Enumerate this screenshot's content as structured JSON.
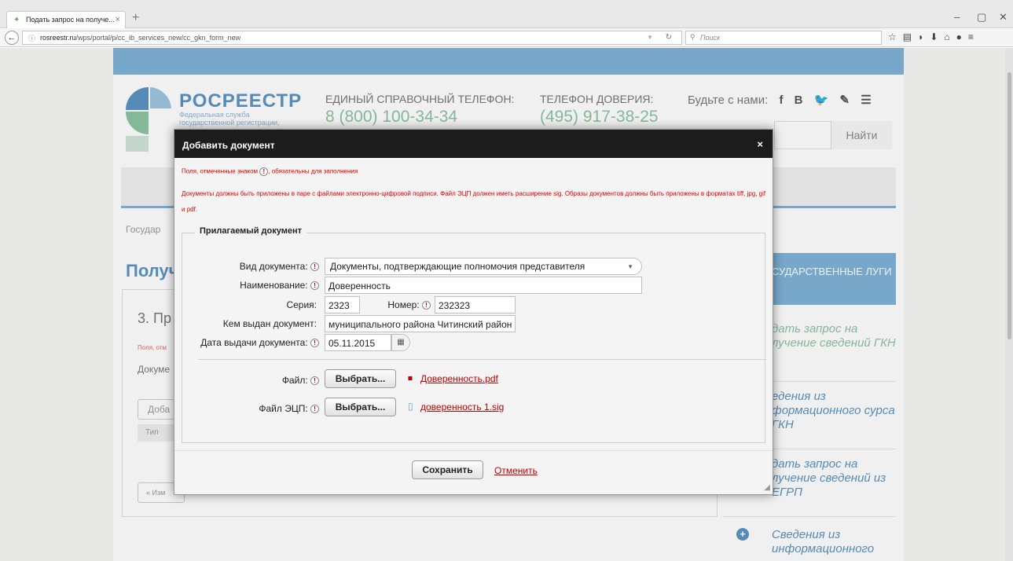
{
  "browser": {
    "tab_title": "Подать запрос на получе...",
    "tab_close": "×",
    "new_tab": "+",
    "url_host": "rosreestr.ru",
    "url_path": "/wps/portal/p/cc_ib_services_new/cc_gkn_form_new",
    "search_placeholder": "Поиск",
    "window_controls": [
      "–",
      "▢",
      "✕"
    ]
  },
  "site": {
    "logo_title": "РОСРЕЕСТР",
    "logo_sub": "Федеральная служба государственной регистрации,",
    "phone_label": "ЕДИНЫЙ СПРАВОЧНЫЙ ТЕЛЕФОН:",
    "phone_number": "8 (800) 100-34-34",
    "trust_label": "ТЕЛЕФОН ДОВЕРИЯ:",
    "trust_number": "(495) 917-38-25",
    "social_label": "Будьте с нами:",
    "social_icons": [
      "f",
      "B",
      "🐦",
      "✎",
      "☰"
    ],
    "find_button": "Найти",
    "breadcrumb": "Государ",
    "page_title": "Получ",
    "step_title": "3. Пр",
    "bg_required": "Поля, отм",
    "bg_documents": "Докуме",
    "bg_add_button": "Доба",
    "bg_type_col": "Тип",
    "bg_back_button": "« Изм",
    "services_header": "СУДАРСТВЕННЫЕ ЛУГИ",
    "services": [
      "дать запрос на лучение сведений ГКН",
      "едения из формационного сурса ГКН",
      "дать запрос на лучение сведений из ЕГРП",
      "Сведения из информационного"
    ],
    "service_icon": "+"
  },
  "modal": {
    "title": "Добавить документ",
    "close": "×",
    "required_note_before": "Поля, отмеченные знаком",
    "required_note_after": ", обязательны для заполнения",
    "required_icon": "!",
    "warning": "Документы должны быть приложены в паре с файлами электронно-цифровой подписи. Файл ЭЦП должен иметь расширение sig. Образы документов должны быть приложены в форматах tiff, jpg, gif и pdf.",
    "legend": "Прилагаемый документ",
    "labels": {
      "doc_type": "Вид документа:",
      "name": "Наименование:",
      "series": "Серия:",
      "number": "Номер:",
      "issued_by": "Кем выдан документ:",
      "issue_date": "Дата выдачи документа:",
      "file": "Файл:",
      "sig_file": "Файл ЭЦП:"
    },
    "values": {
      "doc_type": "Документы, подтверждающие полномочия представителя",
      "name": "Доверенность",
      "series": "2323",
      "number": "232323",
      "issued_by": "муниципального района Читинский район",
      "issue_date": "05.11.2015"
    },
    "choose_button": "Выбрать...",
    "file_name": "Доверенность.pdf",
    "sig_name": "доверенность 1.sig",
    "save_button": "Сохранить",
    "cancel_link": "Отменить"
  },
  "colors": {
    "accent_blue": "#7fb2d6",
    "required_red": "#e00000",
    "modal_header": "#1c1c1c"
  }
}
